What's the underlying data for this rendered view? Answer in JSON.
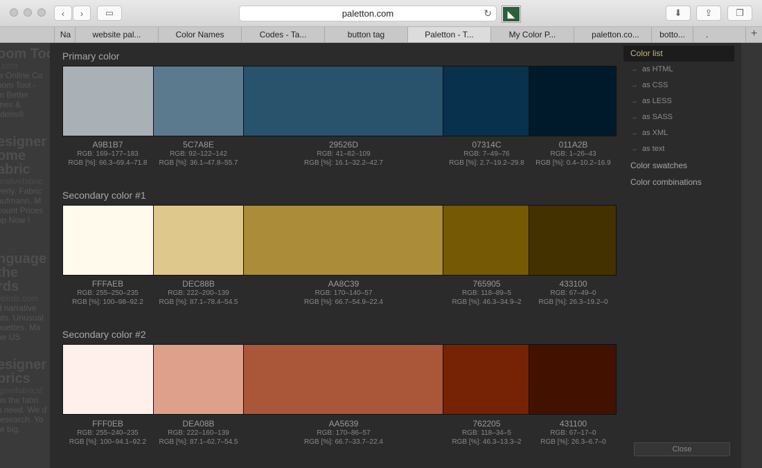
{
  "browser": {
    "url": "paletton.com",
    "tabs": [
      {
        "label": "Na",
        "active": false
      },
      {
        "label": "website pal...",
        "active": false
      },
      {
        "label": "Color Names",
        "active": false
      },
      {
        "label": "Codes - Ta...",
        "active": false
      },
      {
        "label": "button tag",
        "active": false
      },
      {
        "label": "Paletton - T...",
        "active": true
      },
      {
        "label": "My Color P...",
        "active": false
      },
      {
        "label": "paletton.co...",
        "active": false
      },
      {
        "label": "botto...",
        "active": false
      },
      {
        "label": ".",
        "active": false
      }
    ]
  },
  "background_page": {
    "blocks": [
      {
        "big": "oom Too",
        "lines": [
          "t.com",
          "w Online Co",
          "oom Tool -",
          "m Better",
          "mes &",
          "rdens®"
        ]
      },
      {
        "big": "esigner",
        "big2": "ome",
        "big3": "abric",
        "lines": [
          "orativefabric",
          "verly, Fabric",
          "aufmann, M",
          "count Prices",
          "op Now !"
        ]
      },
      {
        "big": "nguage",
        "big2": "the",
        "big3": "rds",
        "lines": [
          "ebirds.com",
          "d narrative",
          "nts. Unusual",
          "ouettes. Ma",
          "he US"
        ]
      },
      {
        "big": "esigner",
        "big2": "brics",
        "lines": [
          "ignerfabricsf",
          "us the fabri",
          "u need. We d",
          "research. Yo",
          "re big."
        ]
      }
    ]
  },
  "sections": [
    {
      "title": "Primary color",
      "swatches": [
        {
          "hex": "A9B1B7",
          "color": "#A9B1B7",
          "rgb": "RGB: 169–177–183",
          "pct": "RGB [%]: 66.3–69.4–71.8"
        },
        {
          "hex": "5C7A8E",
          "color": "#5C7A8E",
          "rgb": "RGB: 92–122–142",
          "pct": "RGB [%]: 36.1–47.8–55.7"
        },
        {
          "hex": "29526D",
          "color": "#29526D",
          "rgb": "RGB: 41–82–109",
          "pct": "RGB [%]: 16.1–32.2–42.7"
        },
        {
          "hex": "07314C",
          "color": "#07314C",
          "rgb": "RGB: 7–49–76",
          "pct": "RGB [%]: 2.7–19.2–29.8"
        },
        {
          "hex": "011A2B",
          "color": "#011A2B",
          "rgb": "RGB: 1–26–43",
          "pct": "RGB [%]: 0.4–10.2–16.9"
        }
      ]
    },
    {
      "title": "Secondary color #1",
      "swatches": [
        {
          "hex": "FFFAEB",
          "color": "#FFFAEB",
          "rgb": "RGB: 255–250–235",
          "pct": "RGB [%]: 100–98–92.2"
        },
        {
          "hex": "DEC88B",
          "color": "#DEC88B",
          "rgb": "RGB: 222–200–139",
          "pct": "RGB [%]: 87.1–78.4–54.5"
        },
        {
          "hex": "AA8C39",
          "color": "#AA8C39",
          "rgb": "RGB: 170–140–57",
          "pct": "RGB [%]: 66.7–54.9–22.4"
        },
        {
          "hex": "765905",
          "color": "#765905",
          "rgb": "RGB: 118–89–5",
          "pct": "RGB [%]: 46.3–34.9–2"
        },
        {
          "hex": "433100",
          "color": "#433100",
          "rgb": "RGB: 67–49–0",
          "pct": "RGB [%]: 26.3–19.2–0"
        }
      ]
    },
    {
      "title": "Secondary color #2",
      "swatches": [
        {
          "hex": "FFF0EB",
          "color": "#FFF0EB",
          "rgb": "RGB: 255–240–235",
          "pct": "RGB [%]: 100–94.1–92.2"
        },
        {
          "hex": "DEA08B",
          "color": "#DEA08B",
          "rgb": "RGB: 222–160–139",
          "pct": "RGB [%]: 87.1–62.7–54.5"
        },
        {
          "hex": "AA5639",
          "color": "#AA5639",
          "rgb": "RGB: 170–86–57",
          "pct": "RGB [%]: 66.7–33.7–22.4"
        },
        {
          "hex": "762205",
          "color": "#762205",
          "rgb": "RGB: 118–34–5",
          "pct": "RGB [%]: 46.3–13.3–2"
        },
        {
          "hex": "431100",
          "color": "#431100",
          "rgb": "RGB: 67–17–0",
          "pct": "RGB [%]: 26.3–6.7–0"
        }
      ]
    }
  ],
  "sidebar": {
    "header": "Color list",
    "subitems": [
      "as HTML",
      "as CSS",
      "as LESS",
      "as SASS",
      "as XML",
      "as text"
    ],
    "arrow": "→",
    "items": [
      "Color swatches",
      "Color combinations"
    ]
  },
  "close_label": "Close"
}
